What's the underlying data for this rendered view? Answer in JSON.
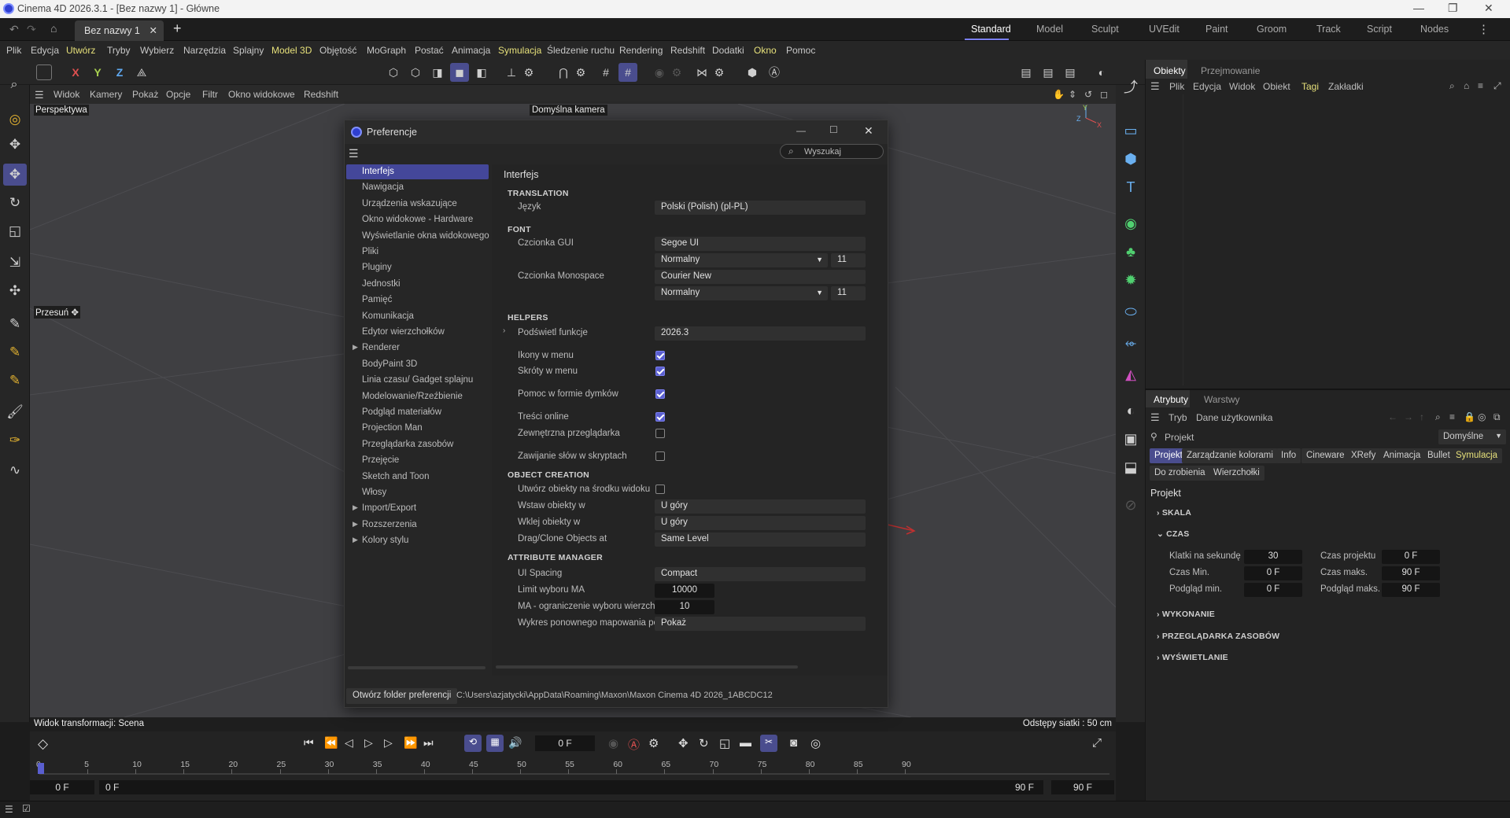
{
  "window": {
    "title": "Cinema 4D 2026.3.1 - [Bez nazwy 1] - Główne"
  },
  "doc_tab": {
    "label": "Bez nazwy 1"
  },
  "layouts": [
    "Standard",
    "Model",
    "Sculpt",
    "UVEdit",
    "Paint",
    "Groom",
    "Track",
    "Script",
    "Nodes"
  ],
  "menu": [
    "Plik",
    "Edycja",
    "Utwórz",
    "Tryby",
    "Wybierz",
    "Narzędzia",
    "Splajny",
    "Model 3D",
    "Objętość",
    "MoGraph",
    "Postać",
    "Animacja",
    "Symulacja",
    "Śledzenie ruchu",
    "Rendering",
    "Redshift",
    "Dodatki",
    "Okno",
    "Pomoc"
  ],
  "axes": {
    "x": "X",
    "y": "Y",
    "z": "Z"
  },
  "viewport": {
    "menu": [
      "Widok",
      "Kamery",
      "Pokaż",
      "Opcje",
      "Filtr",
      "Okno widokowe",
      "Redshift"
    ],
    "view_name": "Perspektywa",
    "camera": "Domyślna kamera",
    "move_label": "Przesuń",
    "transform_status": "Widok transformacji: Scena",
    "grid_status": "Odstępy siatki : 50 cm"
  },
  "timeline": {
    "current_frame": "0 F",
    "start_field": "0 F",
    "start_field2": "0 F",
    "end_field": "90 F",
    "end_field2": "90 F",
    "ticks": [
      "0",
      "5",
      "10",
      "15",
      "20",
      "25",
      "30",
      "35",
      "40",
      "45",
      "50",
      "55",
      "60",
      "65",
      "70",
      "75",
      "80",
      "85",
      "90"
    ]
  },
  "objects_panel": {
    "tabs": [
      "Obiekty",
      "Przejmowanie"
    ],
    "menu": [
      "Plik",
      "Edycja",
      "Widok",
      "Obiekt",
      "Tagi",
      "Zakładki"
    ]
  },
  "attributes_panel": {
    "tabs": [
      "Atrybuty",
      "Warstwy"
    ],
    "menu": [
      "Tryb",
      "Dane użytkownika"
    ],
    "mode_label": "Projekt",
    "preset": "Domyślne",
    "chips_row1": [
      "Projekt",
      "Zarządzanie kolorami",
      "Info",
      "Cineware",
      "XRefy",
      "Animacja",
      "Bullet",
      "Symulacja"
    ],
    "chips_row2": [
      "Do zrobienia",
      "Wierzchołki"
    ],
    "heading": "Projekt",
    "sections": [
      "SKALA",
      "CZAS",
      "WYKONANIE",
      "PRZEGLĄDARKA ZASOBÓW",
      "WYŚWIETLANIE"
    ],
    "czas": {
      "fps_label": "Klatki na sekundę",
      "fps": "30",
      "proj_time_label": "Czas projektu",
      "proj_time": "0 F",
      "min_label": "Czas Min.",
      "min": "0 F",
      "max_label": "Czas maks.",
      "max": "90 F",
      "prev_min_label": "Podgląd min.",
      "prev_min": "0 F",
      "prev_max_label": "Podgląd maks.",
      "prev_max": "90 F"
    }
  },
  "dialog": {
    "title": "Preferencje",
    "search_placeholder": "Wyszukaj",
    "tree": [
      "Interfejs",
      "Nawigacja",
      "Urządzenia wskazujące",
      "Okno widokowe - Hardware",
      "Wyświetlanie okna widokowego",
      "Pliki",
      "Pluginy",
      "Jednostki",
      "Pamięć",
      "Komunikacja",
      "Edytor wierzchołków",
      "Renderer",
      "BodyPaint 3D",
      "Linia czasu/ Gadget splajnu",
      "Modelowanie/Rzeźbienie",
      "Podgląd materiałów",
      "Projection Man",
      "Przeglądarka zasobów",
      "Przejęcie",
      "Sketch and Toon",
      "Włosy",
      "Import/Export",
      "Rozszerzenia",
      "Kolory stylu"
    ],
    "heading": "Interfejs",
    "sec_translation": "TRANSLATION",
    "lang_label": "Język",
    "lang_value": "Polski (Polish) (pl-PL)",
    "sec_font": "FONT",
    "gui_font_label": "Czcionka GUI",
    "gui_font": "Segoe UI",
    "gui_style": "Normalny",
    "gui_size": "11",
    "mono_font_label": "Czcionka Monospace",
    "mono_font": "Courier New",
    "mono_style": "Normalny",
    "mono_size": "11",
    "sec_helpers": "HELPERS",
    "highlight_label": "Podświetl funkcje",
    "highlight_value": "2026.3",
    "icons_label": "Ikony w menu",
    "shortcuts_label": "Skróty w menu",
    "tooltips_label": "Pomoc w formie dymków",
    "online_label": "Treści online",
    "ext_browser_label": "Zewnętrzna przeglądarka",
    "wrap_label": "Zawijanie słów w skryptach",
    "sec_object": "OBJECT CREATION",
    "center_label": "Utwórz obiekty na środku widoku",
    "insert_label": "Wstaw obiekty w",
    "insert_value": "U góry",
    "paste_label": "Wklej obiekty w",
    "paste_value": "U góry",
    "drag_label": "Drag/Clone Objects at",
    "drag_value": "Same Level",
    "sec_attr": "ATTRIBUTE MANAGER",
    "spacing_label": "UI Spacing",
    "spacing_value": "Compact",
    "limit_label": "Limit wyboru MA",
    "limit_value": "10000",
    "vert_label": "MA - ograniczenie wyboru wierzchołków",
    "vert_value": "10",
    "remap_label": "Wykres ponownego mapowania pól",
    "remap_value": "Pokaż",
    "open_folder_btn": "Otwórz folder preferencji",
    "path": "C:\\Users\\azjatycki\\AppData\\Roaming\\Maxon\\Maxon Cinema 4D 2026_1ABCDC12"
  }
}
